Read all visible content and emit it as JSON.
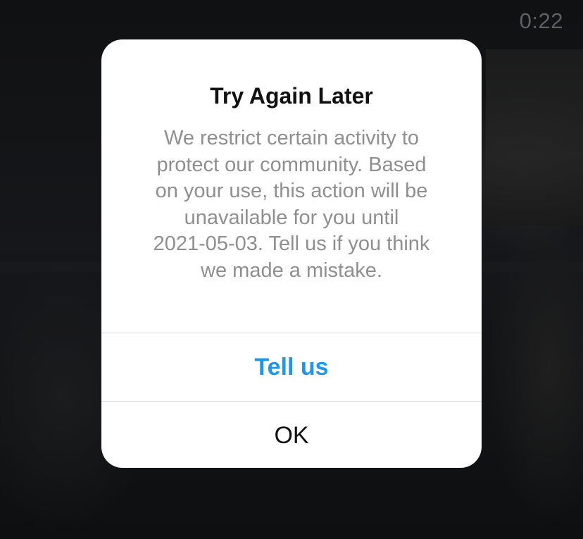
{
  "video": {
    "timer": "0:22"
  },
  "dialog": {
    "title": "Try Again Later",
    "message": "We restrict certain activity to\nprotect our community. Based\non your use, this action will be\nunavailable for you until\n2021-05-03. Tell us if you think\nwe made a mistake.",
    "primary_button": "Tell us",
    "secondary_button": "OK"
  },
  "colors": {
    "accent": "#1d97ec",
    "message_text": "#8f8f8f",
    "title_text": "#111111",
    "dialog_bg": "#ffffff"
  }
}
